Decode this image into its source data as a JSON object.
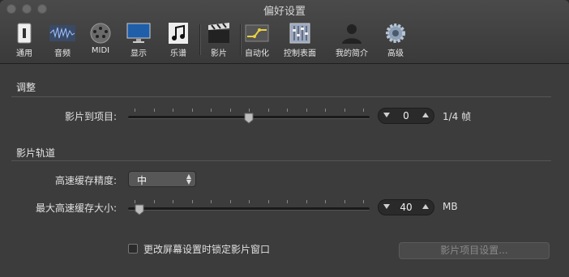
{
  "window": {
    "title": "偏好设置"
  },
  "toolbar": {
    "items": [
      {
        "label": "通用",
        "icon": "general-switch-icon"
      },
      {
        "label": "音频",
        "icon": "audio-waveform-icon"
      },
      {
        "label": "MIDI",
        "icon": "midi-connector-icon"
      },
      {
        "label": "显示",
        "icon": "display-monitor-icon"
      },
      {
        "label": "乐谱",
        "icon": "score-notes-icon"
      },
      {
        "label": "影片",
        "icon": "movie-clapper-icon"
      },
      {
        "label": "自动化",
        "icon": "automation-icon"
      },
      {
        "label": "控制表面",
        "icon": "control-surface-icon"
      },
      {
        "label": "我的简介",
        "icon": "my-profile-icon"
      },
      {
        "label": "高级",
        "icon": "advanced-gear-icon"
      }
    ],
    "selected": "影片"
  },
  "adjust": {
    "heading": "调整",
    "movie_to_project_label": "影片到项目:",
    "movie_to_project_value": "0",
    "movie_to_project_unit": "1/4 帧",
    "slider_fraction": 0.5
  },
  "movie_track": {
    "heading": "影片轨道",
    "cache_resolution_label": "高速缓存精度:",
    "cache_resolution_value": "中",
    "max_cache_label": "最大高速缓存大小:",
    "max_cache_value": "40",
    "max_cache_unit": "MB",
    "max_cache_slider_fraction": 0.02
  },
  "footer": {
    "lock_checkbox_label": "更改屏幕设置时锁定影片窗口",
    "lock_checked": false,
    "project_settings_button": "影片项目设置..."
  }
}
